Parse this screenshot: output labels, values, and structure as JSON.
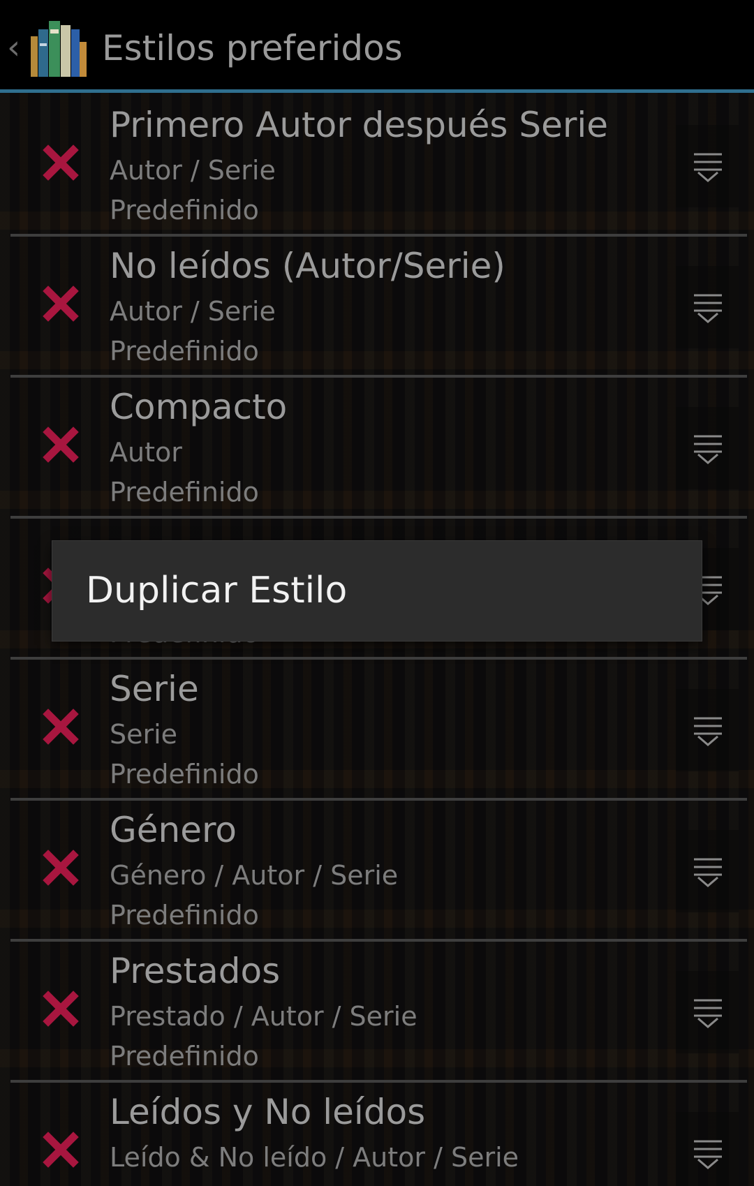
{
  "actionbar": {
    "back_glyph": "‹",
    "title": "Estilos preferidos",
    "icon": "app-bookshelf-icon"
  },
  "styles": [
    {
      "name": "Primero Autor después Serie",
      "groups": "Autor / Serie",
      "kind": "Predefinido"
    },
    {
      "name": "No leídos (Autor/Serie)",
      "groups": "Autor / Serie",
      "kind": "Predefinido"
    },
    {
      "name": "Compacto",
      "groups": "Autor",
      "kind": "Predefinido"
    },
    {
      "name": "",
      "groups": "",
      "kind": "Predefinido"
    },
    {
      "name": "Serie",
      "groups": "Serie",
      "kind": "Predefinido"
    },
    {
      "name": "Género",
      "groups": "Género / Autor / Serie",
      "kind": "Predefinido"
    },
    {
      "name": "Prestados",
      "groups": "Prestado / Autor / Serie",
      "kind": "Predefinido"
    },
    {
      "name": "Leídos y No leídos",
      "groups": "Leído & No leído / Autor / Serie",
      "kind": ""
    }
  ],
  "context_menu": {
    "items": [
      "Duplicar Estilo"
    ]
  },
  "colors": {
    "accent_bar": "#2f6f8f",
    "delete_icon": "#a8163f",
    "dialog_bg": "#2c2c2c"
  }
}
